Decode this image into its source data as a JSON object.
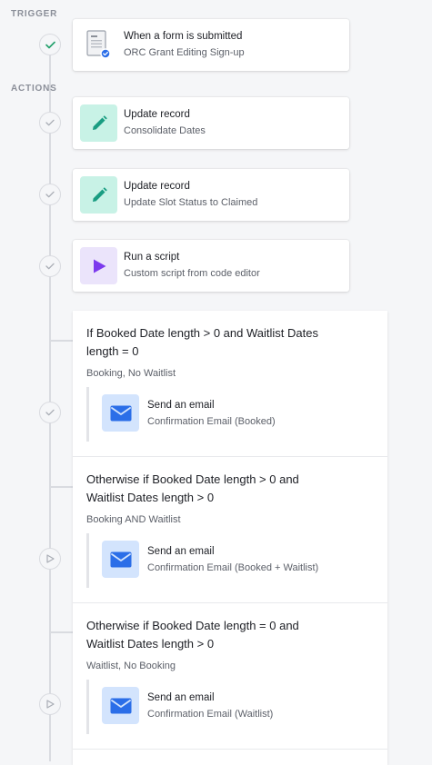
{
  "trigger": {
    "section_label": "TRIGGER",
    "title": "When a form is submitted",
    "subtitle": "ORC Grant Editing Sign-up",
    "icon": "form-icon",
    "status": "complete"
  },
  "actions": {
    "section_label": "ACTIONS",
    "items": [
      {
        "title": "Update record",
        "subtitle": "Consolidate Dates",
        "icon": "pencil-icon",
        "color": "#c8f2e6",
        "icon_color": "#1a9d82"
      },
      {
        "title": "Update record",
        "subtitle": "Update Slot Status to Claimed",
        "icon": "pencil-icon",
        "color": "#c8f2e6",
        "icon_color": "#1a9d82"
      },
      {
        "title": "Run a script",
        "subtitle": "Custom script from code editor",
        "icon": "play-icon",
        "color": "#ebe4fb",
        "icon_color": "#7c3aed"
      }
    ]
  },
  "conditions": [
    {
      "title": "If Booked Date length > 0 and Waitlist Dates length = 0",
      "subtitle": "Booking, No Waitlist",
      "action": {
        "title": "Send an email",
        "subtitle": "Confirmation Email (Booked)",
        "icon": "envelope-icon"
      },
      "status": "complete"
    },
    {
      "title": "Otherwise if Booked Date length > 0 and Waitlist Dates length > 0",
      "subtitle": "Booking AND Waitlist",
      "action": {
        "title": "Send an email",
        "subtitle": "Confirmation Email (Booked + Waitlist)",
        "icon": "envelope-icon"
      },
      "status": "pending"
    },
    {
      "title": "Otherwise if Booked Date length = 0 and Waitlist Dates length > 0",
      "subtitle": "Waitlist, No Booking",
      "action": {
        "title": "Send an email",
        "subtitle": "Confirmation Email (Waitlist)",
        "icon": "envelope-icon"
      },
      "status": "pending"
    }
  ],
  "colors": {
    "email_icon_bg": "#d3e4fd",
    "email_icon_fg": "#2b6ee8",
    "check_complete_trigger": "#22a06b",
    "check_complete": "#a9adb5",
    "pending_icon": "#a9adb5"
  }
}
